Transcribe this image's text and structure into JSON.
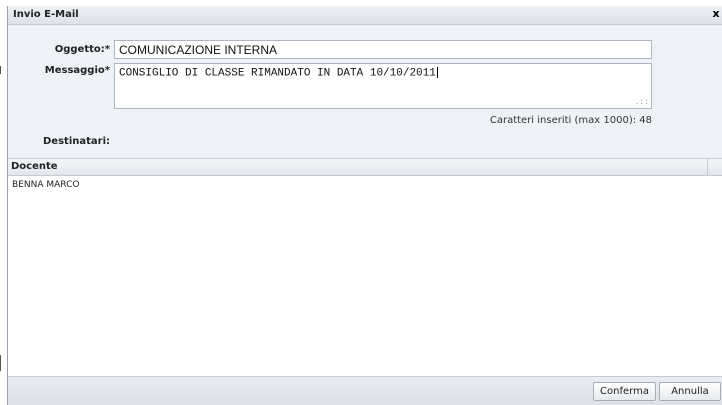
{
  "dialog": {
    "title": "Invio E-Mail",
    "close_label": "x"
  },
  "form": {
    "subject_label": "Oggetto:*",
    "subject_value": "COMUNICAZIONE INTERNA",
    "message_label": "Messaggio*",
    "message_value": "CONSIGLIO DI CLASSE RIMANDATO IN DATA 10/10/2011",
    "counter_text": "Caratteri inseriti (max 1000): 48",
    "recipients_label": "Destinatari:"
  },
  "grid": {
    "column_header": "Docente",
    "rows": [
      "BENNA MARCO"
    ]
  },
  "footer": {
    "confirm_label": "Conferma",
    "cancel_label": "Annulla"
  }
}
